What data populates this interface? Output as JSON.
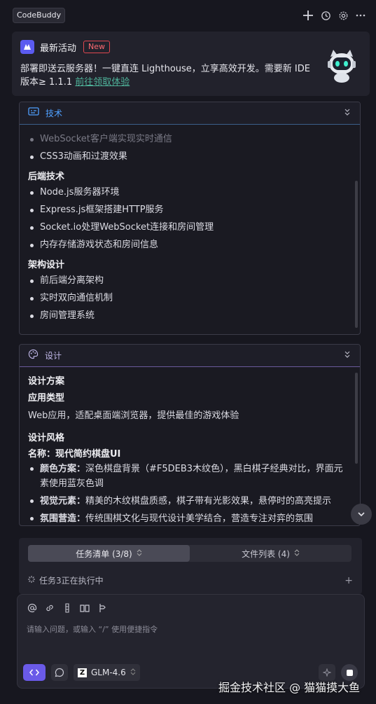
{
  "topbar": {
    "app_name": "CodeBuddy",
    "actions": [
      "plus-icon",
      "history-icon",
      "gear-icon",
      "more-icon"
    ]
  },
  "banner": {
    "title": "最新活动",
    "badge": "New",
    "text": "部署即送云服务器！一键直连 Lighthouse，立享高效开发。需要新 IDE 版本≥ 1.1.1 ",
    "link": "前往领取体验"
  },
  "tech_panel": {
    "title": "技术",
    "frontend_items": [
      "WebSocket客户端实现实时通信",
      "CSS3动画和过渡效果"
    ],
    "backend_heading": "后端技术",
    "backend_items": [
      "Node.js服务器环境",
      "Express.js框架搭建HTTP服务",
      "Socket.io处理WebSocket连接和房间管理",
      "内存存储游戏状态和房间信息"
    ],
    "arch_heading": "架构设计",
    "arch_items": [
      "前后端分离架构",
      "实时双向通信机制",
      "房间管理系统"
    ]
  },
  "design_panel": {
    "title": "设计",
    "scheme_heading": "设计方案",
    "app_type_heading": "应用类型",
    "app_type_text": "Web应用，适配桌面端浏览器，提供最佳的游戏体验",
    "style_heading": "设计风格",
    "name_line": "名称：现代简约棋盘UI",
    "items": [
      {
        "label": "颜色方案：",
        "text": "深色棋盘背景（#F5DEB3木纹色），黑白棋子经典对比，界面元素使用蓝灰色调"
      },
      {
        "label": "视觉元素：",
        "text": "精美的木纹棋盘质感，棋子带有光影效果，悬停时的高亮提示"
      },
      {
        "label": "氛围营造：",
        "text": "传统围棋文化与现代设计美学结合，营造专注对弈的氛围"
      }
    ]
  },
  "tasks": {
    "tab_tasks": "任务清单 (3/8)",
    "tab_files": "文件列表 (4)",
    "status": "任务3正在执行中"
  },
  "composer": {
    "placeholder": "请输入问题，或输入 “/” 使用便捷指令",
    "model": "GLM-4.6",
    "mode_label": "<>"
  },
  "watermark": "掘金技术社区 @ 猫猫摸大鱼",
  "colors": {
    "accent": "#6a5ae8",
    "link": "#4fb39a",
    "badge": "#e0474f",
    "tech_title": "#4fa0ff"
  }
}
